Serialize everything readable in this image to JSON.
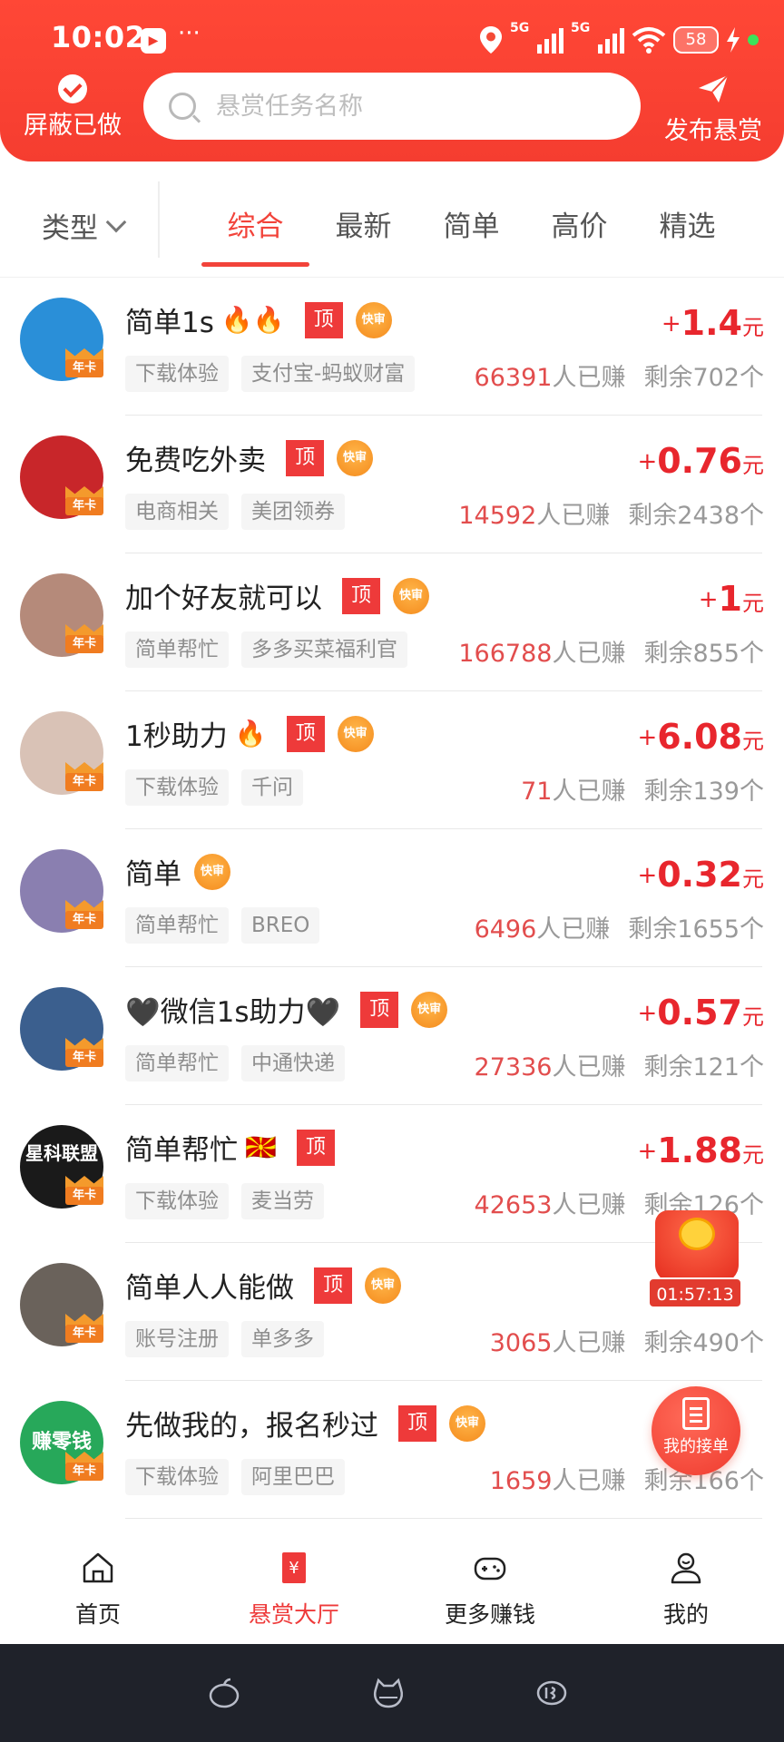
{
  "status_bar": {
    "time": "10:02",
    "dots": "···",
    "network1": "5G",
    "network2": "5G",
    "battery": "58"
  },
  "header": {
    "left_label": "屏蔽已做",
    "search_placeholder": "悬赏任务名称",
    "right_label": "发布悬赏"
  },
  "filter": {
    "type_label": "类型",
    "tabs": [
      "综合",
      "最新",
      "简单",
      "高价",
      "精选"
    ],
    "active_tab": "综合"
  },
  "badges": {
    "top": "顶",
    "fast": "快审",
    "annual": "年卡"
  },
  "units": {
    "yuan": "元",
    "earned": "人已赚",
    "remaining_prefix": "剩余",
    "remaining_suffix": "个"
  },
  "tasks": [
    {
      "title": "简单1s",
      "emoji": "🔥🔥",
      "top": "顶",
      "fast": "快审",
      "plus": "+",
      "price": "1.4",
      "tag1": "下载体验",
      "tag2": "支付宝-蚂蚁财富",
      "earned": "66391",
      "remaining": "702",
      "avatar_text": "",
      "avatar_color": "#2a8fd8"
    },
    {
      "title": "免费吃外卖",
      "emoji": "",
      "top": "顶",
      "fast": "快审",
      "plus": "+",
      "price": "0.76",
      "tag1": "电商相关",
      "tag2": "美团领券",
      "earned": "14592",
      "remaining": "2438",
      "avatar_text": "",
      "avatar_color": "#c8262a"
    },
    {
      "title": "加个好友就可以",
      "emoji": "",
      "top": "顶",
      "fast": "快审",
      "plus": "+",
      "price": "1",
      "tag1": "简单帮忙",
      "tag2": "多多买菜福利官",
      "earned": "166788",
      "remaining": "855",
      "avatar_text": "",
      "avatar_color": "#b58a7a"
    },
    {
      "title": "1秒助力",
      "emoji": "🔥",
      "top": "顶",
      "fast": "快审",
      "plus": "+",
      "price": "6.08",
      "tag1": "下载体验",
      "tag2": "千问",
      "earned": "71",
      "remaining": "139",
      "avatar_text": "",
      "avatar_color": "#d9c2b6"
    },
    {
      "title": "简单",
      "emoji": "",
      "top": "",
      "fast": "快审",
      "plus": "+",
      "price": "0.32",
      "tag1": "简单帮忙",
      "tag2": "BREO",
      "earned": "6496",
      "remaining": "1655",
      "avatar_text": "",
      "avatar_color": "#8a7fb0"
    },
    {
      "title": "🖤微信1s助力🖤",
      "emoji": "",
      "top": "顶",
      "fast": "快审",
      "plus": "+",
      "price": "0.57",
      "tag1": "简单帮忙",
      "tag2": "中通快递",
      "earned": "27336",
      "remaining": "121",
      "avatar_text": "",
      "avatar_color": "#3b5f8e"
    },
    {
      "title": "简单帮忙",
      "emoji": "🇲🇰",
      "top": "顶",
      "fast": "",
      "plus": "+",
      "price": "1.88",
      "tag1": "下载体验",
      "tag2": "麦当劳",
      "earned": "42653",
      "remaining": "126",
      "avatar_text": "星科联盟",
      "avatar_color": "#1a1a1a"
    },
    {
      "title": "简单人人能做",
      "emoji": "",
      "top": "顶",
      "fast": "快审",
      "plus": "+",
      "price": "",
      "tag1": "账号注册",
      "tag2": "单多多",
      "earned": "3065",
      "remaining": "490",
      "avatar_text": "",
      "avatar_color": "#6a625b"
    },
    {
      "title": "先做我的，报名秒过",
      "emoji": "",
      "top": "顶",
      "fast": "快审",
      "plus": "",
      "price": "",
      "tag1": "下载体验",
      "tag2": "阿里巴巴",
      "earned": "1659",
      "remaining": "166",
      "avatar_text": "赚零钱",
      "avatar_color": "#27a85a"
    }
  ],
  "floating": {
    "timer": "01:57:13",
    "orders_label": "我的接单"
  },
  "bottom_nav": {
    "items": [
      "首页",
      "悬赏大厅",
      "更多赚钱",
      "我的"
    ],
    "active": "悬赏大厅"
  },
  "colors": {
    "brand": "#f53d30",
    "price": "#e8262d",
    "tag_top": "#ee3a3a",
    "fast": "#f48a1c"
  }
}
